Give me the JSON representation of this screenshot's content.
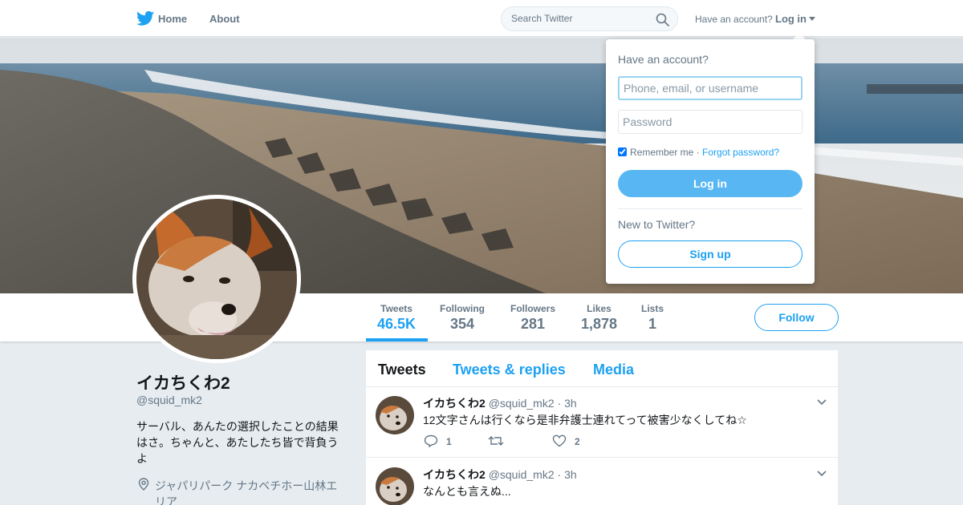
{
  "nav": {
    "home": "Home",
    "about": "About",
    "search_placeholder": "Search Twitter",
    "have_account": "Have an account?",
    "login": "Log in"
  },
  "profile": {
    "name": "イカちくわ2",
    "handle": "@squid_mk2",
    "bio": "サーバル、あんたの選択したことの結果はさ。ちゃんと、あたしたち皆で背負うよ",
    "location": "ジャパリパーク ナカベチホー山林エリア",
    "follow": "Follow"
  },
  "stats": [
    {
      "label": "Tweets",
      "value": "46.5K"
    },
    {
      "label": "Following",
      "value": "354"
    },
    {
      "label": "Followers",
      "value": "281"
    },
    {
      "label": "Likes",
      "value": "1,878"
    },
    {
      "label": "Lists",
      "value": "1"
    }
  ],
  "tabs": [
    "Tweets",
    "Tweets & replies",
    "Media"
  ],
  "tweets": [
    {
      "name": "イカちくわ2",
      "handle": "@squid_mk2",
      "sep": "·",
      "time": "3h",
      "text": "12文字さんは行くなら是非弁護士連れてって被害少なくしてね☆",
      "replies": "1",
      "likes": "2"
    },
    {
      "name": "イカちくわ2",
      "handle": "@squid_mk2",
      "sep": "·",
      "time": "3h",
      "text": "なんとも言えぬ..."
    }
  ],
  "login_dropdown": {
    "title": "Have an account?",
    "username_placeholder": "Phone, email, or username",
    "password_placeholder": "Password",
    "remember": "Remember me",
    "sep": "·",
    "forgot": "Forgot password?",
    "login_button": "Log in",
    "new_to": "New to Twitter?",
    "signup_button": "Sign up"
  },
  "colors": {
    "accent": "#1da1f2",
    "login_button": "#58b7f2",
    "background": "#e6ecf0"
  }
}
